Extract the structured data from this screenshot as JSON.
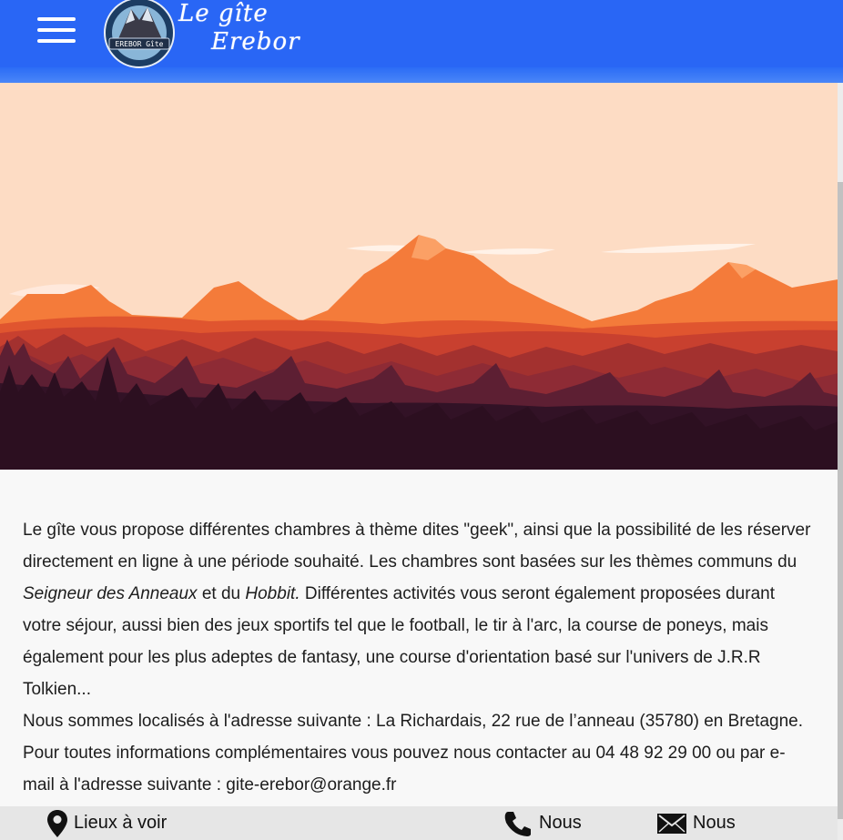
{
  "header": {
    "menu_icon": "hamburger-menu-icon",
    "logo_line1": "Le gîte",
    "logo_line2": "Erebor",
    "emblem_text": "EREBOR Gîte",
    "colors": {
      "bar": "#2966f5",
      "text": "#ffffff"
    }
  },
  "hero": {
    "colors": {
      "sky": "#fddcc4",
      "far_mountains": "#f47b3a",
      "mid_hills": "#c8402f",
      "forest_light": "#8e2b35",
      "forest_dark": "#321226"
    }
  },
  "content": {
    "p1_a": "Le gîte vous propose différentes chambres à thème dites \"geek\", ainsi que la possibilité de les réserver directement en ligne à une période souhaité. Les chambres sont basées sur les thèmes communs du ",
    "p1_em1": "Seigneur des Anneaux",
    "p1_b": " et du ",
    "p1_em2": "Hobbit.",
    "p1_c": " Différentes activités vous seront également proposées durant votre séjour, aussi bien des jeux sportifs tel que le football, le tir à l'arc, la course de poneys, mais également pour les plus adeptes de fantasy, une course d'orientation basé sur l'univers de J.R.R Tolkien...",
    "p2": "Nous sommes localisés à l'adresse suivante : La Richardais, 22 rue de l’anneau (35780) en Bretagne. Pour toutes informations complémentaires vous pouvez nous contacter au 04 48 92 29 00 ou par e-mail à l'adresse suivante : gite-erebor@orange.fr"
  },
  "footer": {
    "places_icon": "map-pin-icon",
    "places_label": "Lieux à voir",
    "phone_icon": "phone-icon",
    "phone_label": "Nous",
    "mail_icon": "envelope-icon",
    "mail_label": "Nous"
  }
}
